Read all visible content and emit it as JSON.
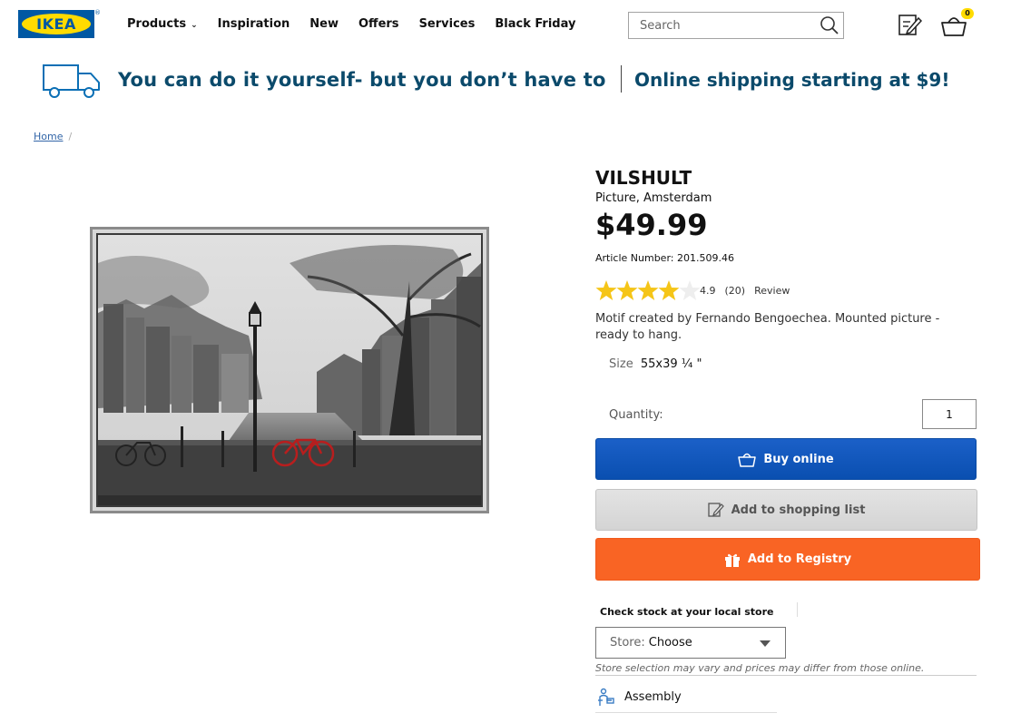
{
  "header": {
    "logo_text": "IKEA",
    "logo_reg": "®",
    "nav": [
      {
        "label": "Products",
        "has_dropdown": true
      },
      {
        "label": "Inspiration"
      },
      {
        "label": "New"
      },
      {
        "label": "Offers"
      },
      {
        "label": "Services"
      },
      {
        "label": "Black Friday"
      }
    ],
    "search_placeholder": "Search",
    "cart_count": "0",
    "icons": {
      "search": "search-icon",
      "list": "shopping-list-icon",
      "cart": "cart-icon"
    }
  },
  "banner": {
    "left_text": "You can do it yourself- but you don’t have to",
    "right_text": "Online shipping starting at $9!",
    "icon": "truck-icon"
  },
  "breadcrumb": {
    "home": "Home",
    "separator": "/"
  },
  "product": {
    "name": "VILSHULT",
    "description": "Picture, Amsterdam",
    "price": "$49.99",
    "article": "Article Number: 201.509.46",
    "rating": {
      "score": "4.9",
      "count": "(20)",
      "review_label": "Review",
      "stars_filled": 4,
      "stars_total": 5
    },
    "motif": "Motif created by Fernando Bengoechea. Mounted picture - ready to hang.",
    "size_label": "Size",
    "size_value": "55x39 ¼ \"",
    "quantity_label": "Quantity:",
    "quantity_value": "1"
  },
  "actions": {
    "buy": "Buy online",
    "shopping_list": "Add to shopping list",
    "registry": "Add to Registry"
  },
  "stock": {
    "title": "Check stock at your local store",
    "store_label": "Store:",
    "store_value": "Choose",
    "note": "Store selection may vary and prices may differ from those online."
  },
  "assembly": {
    "label": "Assembly"
  },
  "colors": {
    "ikea_blue": "#0058a3",
    "ikea_yellow": "#ffdb00",
    "buy_blue": "#0a4fb0",
    "registry_orange": "#f96424",
    "banner_text": "#0b4a6b",
    "star": "#f5c518"
  }
}
